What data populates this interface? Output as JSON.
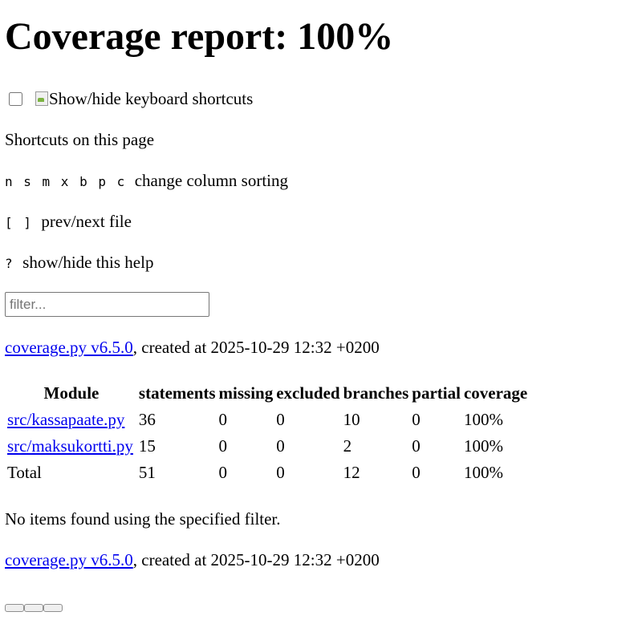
{
  "title": "Coverage report: 100%",
  "keyboard": {
    "toggle_alt": "Show/hide keyboard shortcuts",
    "heading": "Shortcuts on this page",
    "shortcuts": [
      {
        "keys": "n s m x b p c",
        "desc": "change column sorting"
      },
      {
        "keys": "[ ]",
        "desc": "prev/next file"
      },
      {
        "keys": "?",
        "desc": "show/hide this help"
      }
    ]
  },
  "filter": {
    "placeholder": "filter...",
    "value": ""
  },
  "footer": {
    "link_text": "coverage.py v6.5.0",
    "created_text": ", created at 2025-10-29 12:32 +0200"
  },
  "table": {
    "headers": [
      "Module",
      "statements",
      "missing",
      "excluded",
      "branches",
      "partial",
      "coverage"
    ],
    "rows": [
      {
        "module": "src/kassapaate.py",
        "statements": "36",
        "missing": "0",
        "excluded": "0",
        "branches": "10",
        "partial": "0",
        "coverage": "100%"
      },
      {
        "module": "src/maksukortti.py",
        "statements": "15",
        "missing": "0",
        "excluded": "0",
        "branches": "2",
        "partial": "0",
        "coverage": "100%"
      }
    ],
    "total": {
      "module": "Total",
      "statements": "51",
      "missing": "0",
      "excluded": "0",
      "branches": "12",
      "partial": "0",
      "coverage": "100%"
    }
  },
  "no_items": "No items found using the specified filter."
}
